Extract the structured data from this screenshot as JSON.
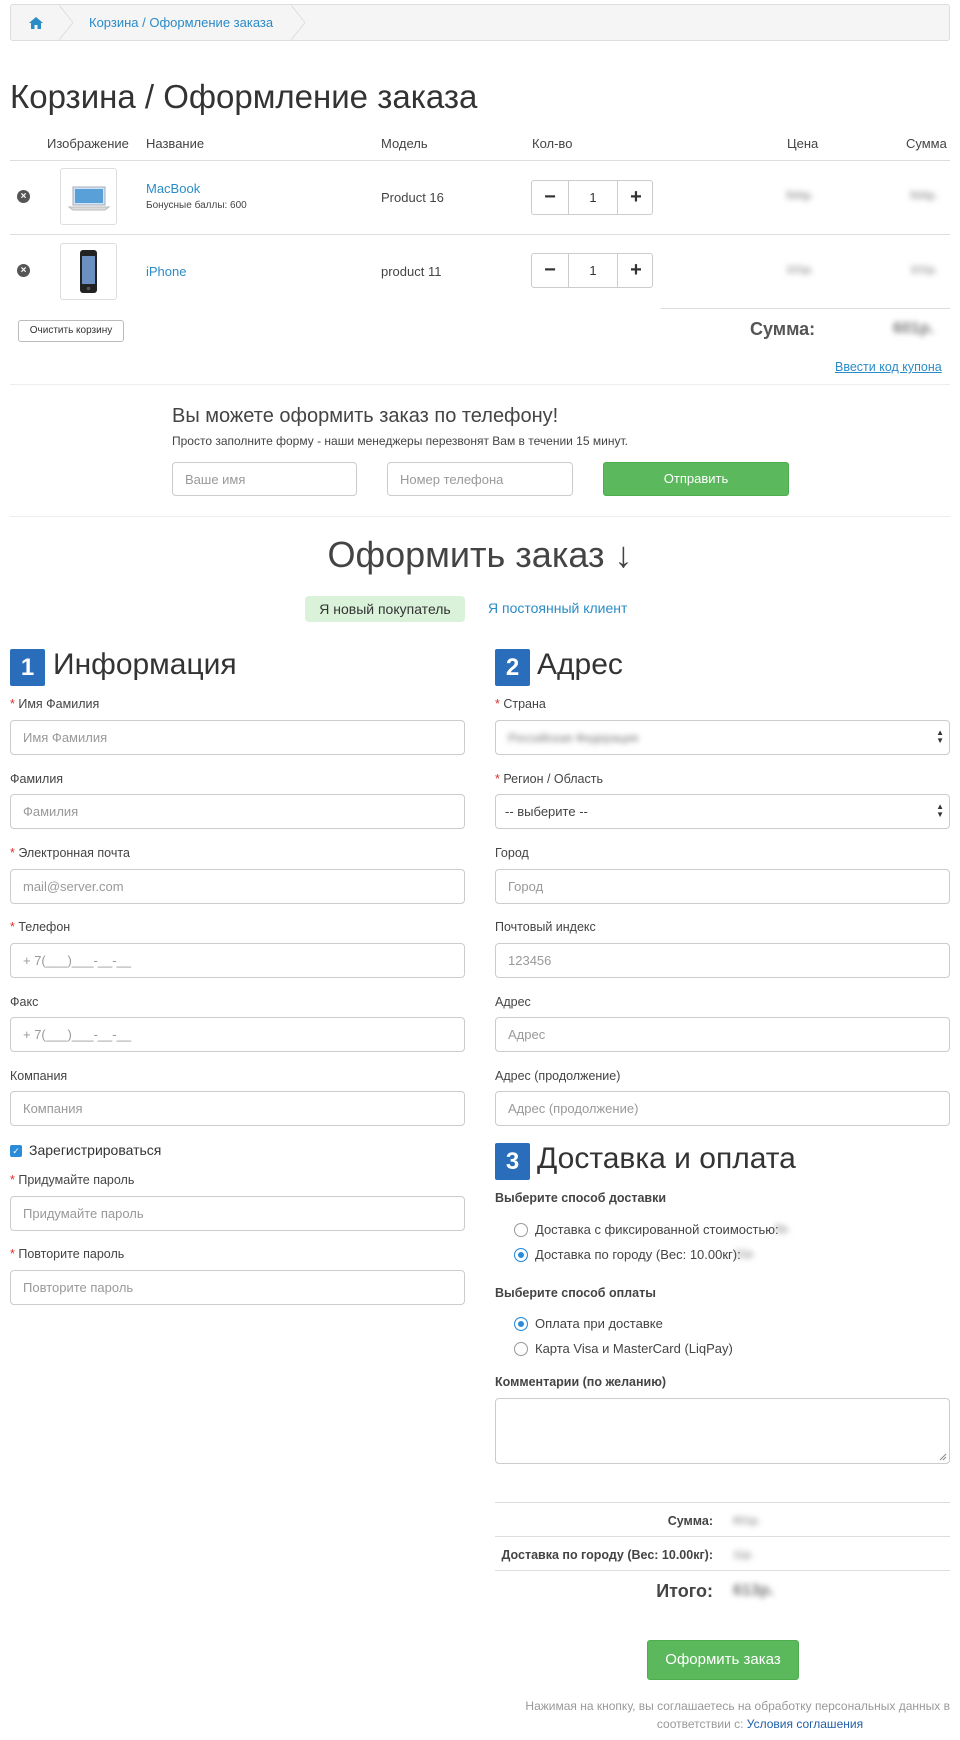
{
  "breadcrumb": {
    "home_icon": "home-icon",
    "current": "Корзина / Оформление заказа"
  },
  "page_title": "Корзина / Оформление заказа",
  "cart": {
    "headers": [
      "Изображение",
      "Название",
      "Модель",
      "Кол-во",
      "Цена",
      "Сумма"
    ],
    "items": [
      {
        "name": "MacBook",
        "bonus": "Бонусные баллы: 600",
        "model": "Product 16",
        "qty": "1",
        "price": "500р.",
        "total": "500р."
      },
      {
        "name": "iPhone",
        "bonus": "",
        "model": "product 11",
        "qty": "1",
        "price": "101р.",
        "total": "101р."
      }
    ],
    "clear_label": "Очистить корзину",
    "sum_label": "Сумма:",
    "sum_value": "601р.",
    "coupon_link": "Ввести код купона"
  },
  "phone_order": {
    "title": "Вы можете оформить заказ по телефону!",
    "subtitle": "Просто заполните форму - наши менеджеры перезвонят Вам в течении 15 минут.",
    "name_placeholder": "Ваше имя",
    "phone_placeholder": "Номер телефона",
    "submit_label": "Отправить"
  },
  "checkout": {
    "title": "Оформить заказ ↓",
    "tab_new": "Я новый покупатель",
    "tab_existing": "Я постоянный клиент"
  },
  "info": {
    "number": "1",
    "title": "Информация",
    "fields": {
      "name_label": "Имя Фамилия",
      "name_placeholder": "Имя Фамилия",
      "lastname_label": "Фамилия",
      "lastname_placeholder": "Фамилия",
      "email_label": "Электронная почта",
      "email_placeholder": "mail@server.com",
      "phone_label": "Телефон",
      "phone_placeholder": "+ 7(___)___-__-__",
      "fax_label": "Факс",
      "fax_placeholder": "+ 7(___)___-__-__",
      "company_label": "Компания",
      "company_placeholder": "Компания",
      "register_label": "Зарегистрироваться",
      "password_label": "Придумайте пароль",
      "password_placeholder": "Придумайте пароль",
      "confirm_label": "Повторите пароль",
      "confirm_placeholder": "Повторите пароль"
    }
  },
  "address": {
    "number": "2",
    "title": "Адрес",
    "fields": {
      "country_label": "Страна",
      "country_value": "Российская Федерация",
      "region_label": "Регион / Область",
      "region_value": "-- выберите --",
      "city_label": "Город",
      "city_placeholder": "Город",
      "zip_label": "Почтовый индекс",
      "zip_placeholder": "123456",
      "address_label": "Адрес",
      "address_placeholder": "Адрес",
      "address2_label": "Адрес (продолжение)",
      "address2_placeholder": "Адрес (продолжение)"
    }
  },
  "delivery": {
    "number": "3",
    "title": "Доставка и оплата",
    "shipping_heading": "Выберите способ доставки",
    "shipping_options": [
      {
        "label": "Доставка с фиксированной стоимостью:",
        "price": "5р.",
        "selected": false
      },
      {
        "label": "Доставка по городу (Вес: 10.00кг):",
        "price": "11р.",
        "selected": true
      }
    ],
    "payment_heading": "Выберите способ оплаты",
    "payment_options": [
      {
        "label": "Оплата при доставке",
        "selected": true
      },
      {
        "label": "Карта Visa и MasterCard (LiqPay)",
        "selected": false
      }
    ],
    "comment_label": "Комментарии (по желанию)"
  },
  "totals": {
    "sum_label": "Сумма:",
    "sum_value": "601р.",
    "ship_label": "Доставка по городу (Вес: 10.00кг):",
    "ship_value": "11р.",
    "total_label": "Итого:",
    "total_value": "613р."
  },
  "confirm": {
    "button_label": "Оформить заказ",
    "note": "Нажимая на кнопку, вы соглашаетесь на обработку персональных данных в",
    "note2": "соответствии с:",
    "terms_link": "Условия соглашения"
  },
  "colors": {
    "accent": "#2a8bc7",
    "green": "#5cb85c",
    "section_blue": "#2a6ebb",
    "required": "#d9302c"
  }
}
